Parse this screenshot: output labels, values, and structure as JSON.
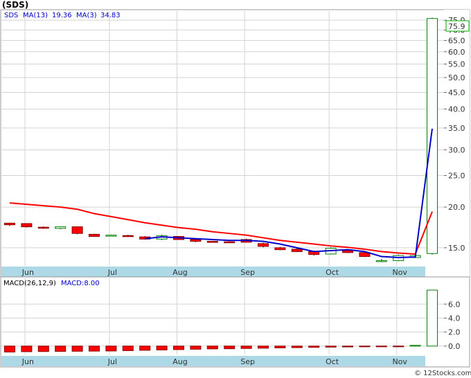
{
  "title": "(SDS)",
  "legend": {
    "ticker": "SDS",
    "ma13_label": "MA(13)",
    "ma13_value": "19.36",
    "ma3_label": "MA(3)",
    "ma3_value": "34.83",
    "macd_label": "MACD(26,12,9)",
    "macd_value_label": "MACD:8.00"
  },
  "last_price_label": "75.9",
  "copyright": "© 12Stocks.com",
  "colors": {
    "down": "#ff0000",
    "up": "#ffffff",
    "up_border": "#008000",
    "ma13": "#ff0000",
    "ma3": "#0000cc",
    "axis_band": "#add8e6",
    "grid": "#d3d3d3"
  },
  "chart_data": [
    {
      "type": "candlestick",
      "name": "price",
      "scale": "log",
      "ylim": [
        13.2,
        80
      ],
      "yticks": [
        "15.0",
        "20.0",
        "25.0",
        "30.0",
        "35.0",
        "40.0",
        "45.0",
        "50.0",
        "55.0",
        "60.0",
        "65.0",
        "70.0",
        "75.0"
      ],
      "month_labels": [
        "Jun",
        "Jul",
        "Aug",
        "Sep",
        "Oct",
        "Nov"
      ],
      "month_positions": [
        1,
        6,
        10,
        14,
        19,
        23
      ],
      "weeks": 26,
      "candles": [
        {
          "o": 17.85,
          "h": 17.9,
          "l": 17.5,
          "c": 17.65
        },
        {
          "o": 17.8,
          "h": 17.85,
          "l": 17.3,
          "c": 17.4
        },
        {
          "o": 17.35,
          "h": 17.45,
          "l": 17.15,
          "c": 17.3
        },
        {
          "o": 17.2,
          "h": 17.45,
          "l": 17.1,
          "c": 17.4
        },
        {
          "o": 17.4,
          "h": 17.45,
          "l": 16.5,
          "c": 16.6
        },
        {
          "o": 16.5,
          "h": 16.55,
          "l": 16.2,
          "c": 16.25
        },
        {
          "o": 16.35,
          "h": 16.45,
          "l": 16.3,
          "c": 16.4
        },
        {
          "o": 16.35,
          "h": 16.45,
          "l": 16.2,
          "c": 16.25
        },
        {
          "o": 16.2,
          "h": 16.3,
          "l": 15.9,
          "c": 15.95
        },
        {
          "o": 15.95,
          "h": 16.45,
          "l": 15.85,
          "c": 16.35
        },
        {
          "o": 16.25,
          "h": 16.3,
          "l": 15.85,
          "c": 15.9
        },
        {
          "o": 15.9,
          "h": 16.0,
          "l": 15.6,
          "c": 15.7
        },
        {
          "o": 15.7,
          "h": 15.75,
          "l": 15.6,
          "c": 15.65
        },
        {
          "o": 15.65,
          "h": 15.7,
          "l": 15.55,
          "c": 15.6
        },
        {
          "o": 15.9,
          "h": 16.0,
          "l": 15.55,
          "c": 15.6
        },
        {
          "o": 15.45,
          "h": 15.55,
          "l": 15.05,
          "c": 15.15
        },
        {
          "o": 15.0,
          "h": 15.1,
          "l": 14.75,
          "c": 14.8
        },
        {
          "o": 14.85,
          "h": 14.95,
          "l": 14.55,
          "c": 14.6
        },
        {
          "o": 14.6,
          "h": 14.7,
          "l": 14.2,
          "c": 14.3
        },
        {
          "o": 14.35,
          "h": 15.05,
          "l": 14.3,
          "c": 14.95
        },
        {
          "o": 14.7,
          "h": 14.75,
          "l": 14.45,
          "c": 14.5
        },
        {
          "o": 14.5,
          "h": 14.55,
          "l": 14.05,
          "c": 14.1
        },
        {
          "o": 13.7,
          "h": 13.85,
          "l": 13.55,
          "c": 13.7
        },
        {
          "o": 13.7,
          "h": 14.3,
          "l": 13.65,
          "c": 14.2
        },
        {
          "o": 14.0,
          "h": 14.3,
          "l": 13.95,
          "c": 14.2
        },
        {
          "o": 14.4,
          "h": 76.3,
          "l": 14.3,
          "c": 75.9
        }
      ],
      "ma13": [
        20.6,
        20.4,
        20.2,
        20.0,
        19.7,
        19.1,
        18.7,
        18.3,
        17.9,
        17.6,
        17.3,
        17.1,
        16.8,
        16.6,
        16.4,
        16.1,
        15.8,
        15.6,
        15.4,
        15.2,
        15.05,
        14.85,
        14.6,
        14.45,
        14.35,
        19.36
      ],
      "ma3": [
        null,
        null,
        null,
        null,
        null,
        null,
        null,
        null,
        16.0,
        16.2,
        16.1,
        16.0,
        15.9,
        15.8,
        15.8,
        15.7,
        15.4,
        15.0,
        14.6,
        14.7,
        14.8,
        14.6,
        14.1,
        14.0,
        14.05,
        34.83
      ]
    },
    {
      "type": "bar",
      "name": "MACD",
      "ylim": [
        -1.2,
        8.5
      ],
      "yticks": [
        "0.0",
        "2.0",
        "4.0",
        "6.0"
      ],
      "ytick_values": [
        0,
        2,
        4,
        6
      ],
      "month_labels": [
        "Jun",
        "Jul",
        "Aug",
        "Sep",
        "Oct",
        "Nov"
      ],
      "values": [
        -0.85,
        -0.8,
        -0.78,
        -0.76,
        -0.74,
        -0.72,
        -0.7,
        -0.65,
        -0.6,
        -0.55,
        -0.5,
        -0.45,
        -0.4,
        -0.38,
        -0.34,
        -0.3,
        -0.26,
        -0.22,
        -0.18,
        -0.15,
        -0.12,
        -0.1,
        -0.08,
        -0.05,
        0.1,
        8.0
      ]
    }
  ]
}
